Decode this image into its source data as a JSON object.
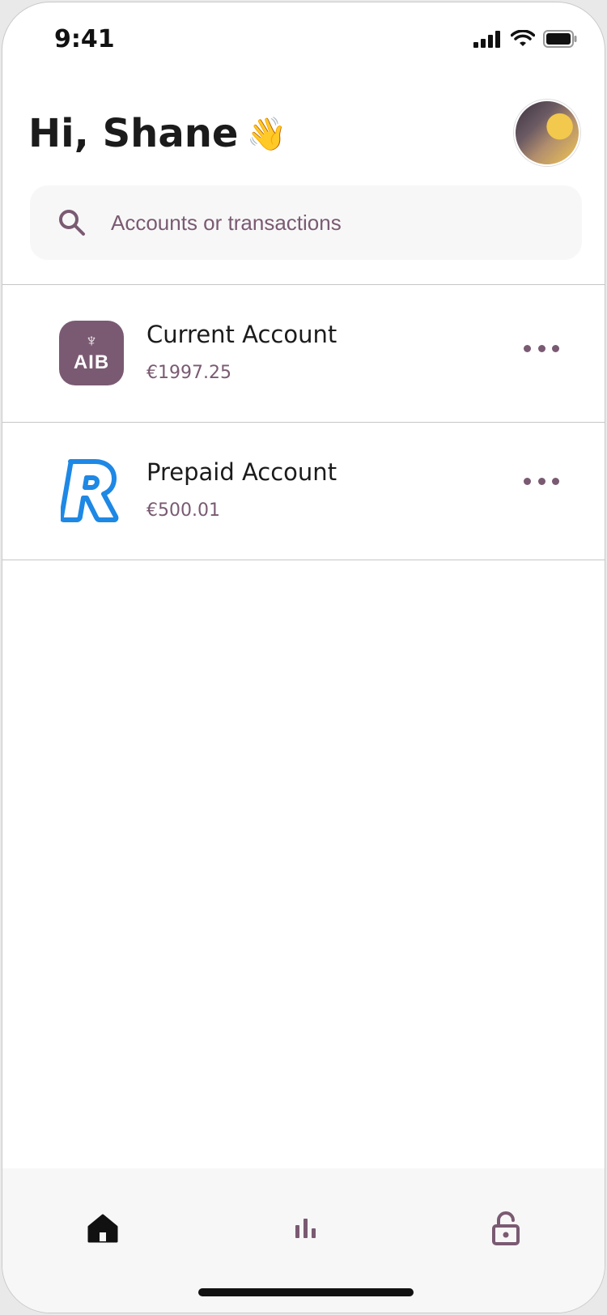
{
  "status_bar": {
    "time": "9:41"
  },
  "header": {
    "greeting": "Hi, Shane",
    "wave_emoji": "👋",
    "avatar_icon": "user-avatar"
  },
  "search": {
    "placeholder": "Accounts or transactions",
    "icon": "search-icon"
  },
  "accounts": [
    {
      "name": "Current Account",
      "balance": "€1997.25",
      "logo": "AIB",
      "logo_icon": "aib-logo"
    },
    {
      "name": "Prepaid Account",
      "balance": "€500.01",
      "logo": "R",
      "logo_icon": "revolut-logo"
    }
  ],
  "tab_bar": {
    "tabs": [
      {
        "icon": "home-icon",
        "active": true
      },
      {
        "icon": "bar-chart-icon",
        "active": false
      },
      {
        "icon": "unlock-icon",
        "active": false
      }
    ]
  },
  "colors": {
    "accent": "#7a5a72",
    "text": "#1b1b1b",
    "revolut_blue": "#1e88e5",
    "surface": "#f7f7f7"
  }
}
